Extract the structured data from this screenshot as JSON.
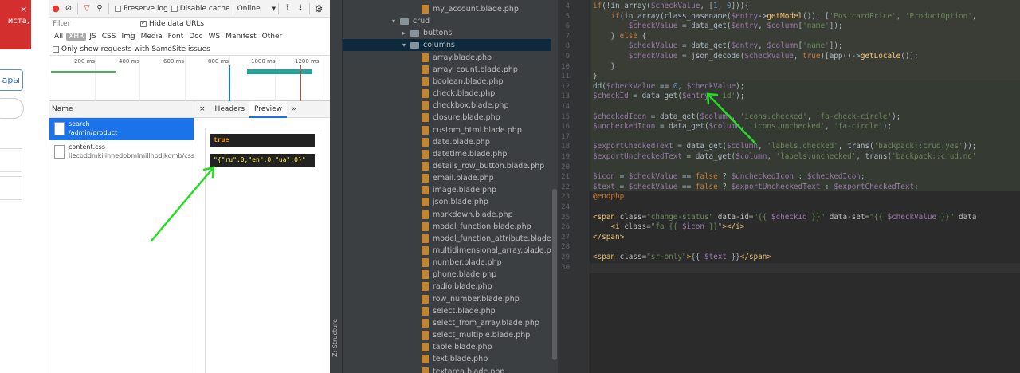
{
  "left_strip": {
    "alert_text_1": "иста,",
    "alert_close": "×",
    "button_label": "ары"
  },
  "devtools": {
    "toolbar": {
      "preserve_log": "Preserve log",
      "disable_cache": "Disable cache",
      "throttle": "Online"
    },
    "filter_placeholder": "Filter",
    "hide_data_urls": "Hide data URLs",
    "filter_types": [
      "All",
      "XHR",
      "JS",
      "CSS",
      "Img",
      "Media",
      "Font",
      "Doc",
      "WS",
      "Manifest",
      "Other"
    ],
    "selected_type": "XHR",
    "same_site": "Only show requests with SameSite issues",
    "timeline_ticks": [
      "200 ms",
      "400 ms",
      "600 ms",
      "800 ms",
      "1000 ms",
      "1200 ms"
    ],
    "name_header": "Name",
    "requests": [
      {
        "name": "search",
        "path": "/admin/product"
      },
      {
        "name": "content.css",
        "path": "liecbddmkiiihnedobmlmillhodjkdmb/css"
      }
    ],
    "detail_tabs": [
      "×",
      "Headers",
      "Preview",
      "»"
    ],
    "preview_lines": [
      "true",
      "\"{\"ru\":0,\"en\":0,\"ua\":0}\""
    ]
  },
  "ide": {
    "structure_label": "Z: Structure",
    "tree": [
      {
        "label": "my_account.blade.php",
        "type": "file",
        "indent": 2
      },
      {
        "label": "crud",
        "type": "folder",
        "indent": 0,
        "open": true
      },
      {
        "label": "buttons",
        "type": "folder",
        "indent": 1,
        "open": false
      },
      {
        "label": "columns",
        "type": "folder",
        "indent": 1,
        "open": true
      },
      {
        "label": "array.blade.php",
        "type": "file",
        "indent": 2
      },
      {
        "label": "array_count.blade.php",
        "type": "file",
        "indent": 2
      },
      {
        "label": "boolean.blade.php",
        "type": "file",
        "indent": 2
      },
      {
        "label": "check.blade.php",
        "type": "file",
        "indent": 2
      },
      {
        "label": "checkbox.blade.php",
        "type": "file",
        "indent": 2
      },
      {
        "label": "closure.blade.php",
        "type": "file",
        "indent": 2
      },
      {
        "label": "custom_html.blade.php",
        "type": "file",
        "indent": 2
      },
      {
        "label": "date.blade.php",
        "type": "file",
        "indent": 2
      },
      {
        "label": "datetime.blade.php",
        "type": "file",
        "indent": 2
      },
      {
        "label": "details_row_button.blade.php",
        "type": "file",
        "indent": 2
      },
      {
        "label": "email.blade.php",
        "type": "file",
        "indent": 2
      },
      {
        "label": "image.blade.php",
        "type": "file",
        "indent": 2
      },
      {
        "label": "json.blade.php",
        "type": "file",
        "indent": 2
      },
      {
        "label": "markdown.blade.php",
        "type": "file",
        "indent": 2
      },
      {
        "label": "model_function.blade.php",
        "type": "file",
        "indent": 2
      },
      {
        "label": "model_function_attribute.blade.php",
        "type": "file",
        "indent": 2
      },
      {
        "label": "multidimensional_array.blade.php",
        "type": "file",
        "indent": 2
      },
      {
        "label": "number.blade.php",
        "type": "file",
        "indent": 2
      },
      {
        "label": "phone.blade.php",
        "type": "file",
        "indent": 2
      },
      {
        "label": "radio.blade.php",
        "type": "file",
        "indent": 2
      },
      {
        "label": "row_number.blade.php",
        "type": "file",
        "indent": 2
      },
      {
        "label": "select.blade.php",
        "type": "file",
        "indent": 2
      },
      {
        "label": "select_from_array.blade.php",
        "type": "file",
        "indent": 2
      },
      {
        "label": "select_multiple.blade.php",
        "type": "file",
        "indent": 2
      },
      {
        "label": "table.blade.php",
        "type": "file",
        "indent": 2
      },
      {
        "label": "text.blade.php",
        "type": "file",
        "indent": 2
      },
      {
        "label": "textarea.blade.php",
        "type": "file",
        "indent": 2
      }
    ],
    "line_numbers": [
      "4",
      "5",
      "6",
      "7",
      "8",
      "9",
      "10",
      "11",
      "12",
      "13",
      "14",
      "15",
      "16",
      "17",
      "18",
      "19",
      "20",
      "21",
      "22",
      "23",
      "24",
      "25",
      "26",
      "27",
      "28",
      "29",
      "30"
    ],
    "code_lines": [
      [
        [
          "kw",
          "if"
        ],
        [
          "",
          "(!in_array("
        ],
        [
          "var",
          "$checkValue"
        ],
        [
          "",
          ", ["
        ],
        [
          "num",
          "1"
        ],
        [
          "",
          ", "
        ],
        [
          "num",
          "0"
        ],
        [
          "",
          "])){"
        ]
      ],
      [
        [
          "",
          "    "
        ],
        [
          "kw",
          "if"
        ],
        [
          "",
          "(in_array(class_basename("
        ],
        [
          "var",
          "$entry"
        ],
        [
          "",
          "->"
        ],
        [
          "fn",
          "getModel"
        ],
        [
          "",
          "()), ["
        ],
        [
          "str",
          "'PostcardPrice'"
        ],
        [
          "",
          ", "
        ],
        [
          "str",
          "'ProductOption'"
        ],
        [
          "",
          ","
        ]
      ],
      [
        [
          "",
          "        "
        ],
        [
          "var",
          "$checkValue"
        ],
        [
          "",
          " = data_get("
        ],
        [
          "var",
          "$entry"
        ],
        [
          "",
          ", "
        ],
        [
          "var",
          "$column"
        ],
        [
          "",
          "["
        ],
        [
          "str",
          "'name'"
        ],
        [
          "",
          "]);"
        ]
      ],
      [
        [
          "",
          "    } "
        ],
        [
          "kw",
          "else"
        ],
        [
          "",
          " {"
        ]
      ],
      [
        [
          "",
          "        "
        ],
        [
          "var",
          "$checkValue"
        ],
        [
          "",
          " = data_get("
        ],
        [
          "var",
          "$entry"
        ],
        [
          "",
          ", "
        ],
        [
          "var",
          "$column"
        ],
        [
          "",
          "["
        ],
        [
          "str",
          "'name'"
        ],
        [
          "",
          "]);"
        ]
      ],
      [
        [
          "",
          "        "
        ],
        [
          "var",
          "$checkValue"
        ],
        [
          "",
          " = json_decode("
        ],
        [
          "var",
          "$checkValue"
        ],
        [
          "",
          ", "
        ],
        [
          "kw",
          "true"
        ],
        [
          "",
          ")[app()->"
        ],
        [
          "fn",
          "getLocale"
        ],
        [
          "",
          "()];"
        ]
      ],
      [
        [
          "",
          "    }"
        ]
      ],
      [
        [
          "",
          "}"
        ]
      ],
      [
        [
          "",
          "dd("
        ],
        [
          "var",
          "$checkValue"
        ],
        [
          "",
          " == "
        ],
        [
          "num",
          "0"
        ],
        [
          "",
          ", "
        ],
        [
          "var",
          "$checkValue"
        ],
        [
          "",
          ");"
        ]
      ],
      [
        [
          "var",
          "$checkId"
        ],
        [
          "",
          " = data_get("
        ],
        [
          "var",
          "$entry"
        ],
        [
          "",
          ", "
        ],
        [
          "str",
          "'id'"
        ],
        [
          "",
          ");"
        ]
      ],
      [
        [
          "",
          ""
        ]
      ],
      [
        [
          "var",
          "$checkedIcon"
        ],
        [
          "",
          " = data_get("
        ],
        [
          "var",
          "$column"
        ],
        [
          "",
          ", "
        ],
        [
          "str",
          "'icons.checked'"
        ],
        [
          "",
          ", "
        ],
        [
          "str",
          "'fa-check-circle'"
        ],
        [
          "",
          ");"
        ]
      ],
      [
        [
          "var",
          "$uncheckedIcon"
        ],
        [
          "",
          " = data_get("
        ],
        [
          "var",
          "$column"
        ],
        [
          "",
          ", "
        ],
        [
          "str",
          "'icons.unchecked'"
        ],
        [
          "",
          ", "
        ],
        [
          "str",
          "'fa-circle'"
        ],
        [
          "",
          ");"
        ]
      ],
      [
        [
          "",
          ""
        ]
      ],
      [
        [
          "var",
          "$exportCheckedText"
        ],
        [
          "",
          " = data_get("
        ],
        [
          "var",
          "$column"
        ],
        [
          "",
          ", "
        ],
        [
          "str",
          "'labels.checked'"
        ],
        [
          "",
          ", trans("
        ],
        [
          "str",
          "'backpack::crud.yes'"
        ],
        [
          "",
          "));"
        ]
      ],
      [
        [
          "var",
          "$exportUncheckedText"
        ],
        [
          "",
          " = data_get("
        ],
        [
          "var",
          "$column"
        ],
        [
          "",
          ", "
        ],
        [
          "str",
          "'labels.unchecked'"
        ],
        [
          "",
          ", trans("
        ],
        [
          "str",
          "'backpack::crud.no'"
        ],
        [
          "",
          ""
        ]
      ],
      [
        [
          "",
          ""
        ]
      ],
      [
        [
          "var",
          "$icon"
        ],
        [
          "",
          " = "
        ],
        [
          "var",
          "$checkValue"
        ],
        [
          "",
          " == "
        ],
        [
          "kw",
          "false"
        ],
        [
          "",
          " ? "
        ],
        [
          "var",
          "$uncheckedIcon"
        ],
        [
          "",
          " : "
        ],
        [
          "var",
          "$checkedIcon"
        ],
        [
          "",
          ";"
        ]
      ],
      [
        [
          "var",
          "$text"
        ],
        [
          "",
          " = "
        ],
        [
          "var",
          "$checkValue"
        ],
        [
          "",
          " == "
        ],
        [
          "kw",
          "false"
        ],
        [
          "",
          " ? "
        ],
        [
          "var",
          "$exportUncheckedText"
        ],
        [
          "",
          " : "
        ],
        [
          "var",
          "$exportCheckedText"
        ],
        [
          "",
          ";"
        ]
      ],
      [
        [
          "bl",
          "@endphp"
        ]
      ],
      [
        [
          "",
          ""
        ]
      ],
      [
        [
          "tag",
          "<span "
        ],
        [
          "attr",
          "class="
        ],
        [
          "str",
          "\"change-status\""
        ],
        [
          "attr",
          " data-id="
        ],
        [
          "str",
          "\"{{ "
        ],
        [
          "var",
          "$checkId"
        ],
        [
          "str",
          " }}\""
        ],
        [
          "attr",
          " data-set="
        ],
        [
          "str",
          "\"{{ "
        ],
        [
          "var",
          "$checkValue"
        ],
        [
          "str",
          " }}\""
        ],
        [
          "attr",
          " data"
        ]
      ],
      [
        [
          "",
          "    "
        ],
        [
          "tag",
          "<i "
        ],
        [
          "attr",
          "class="
        ],
        [
          "str",
          "\"fa {{ "
        ],
        [
          "var",
          "$icon"
        ],
        [
          "str",
          " }}\""
        ],
        [
          "tag",
          "></i>"
        ]
      ],
      [
        [
          "tag",
          "</span>"
        ]
      ],
      [
        [
          "",
          ""
        ]
      ],
      [
        [
          "tag",
          "<span "
        ],
        [
          "attr",
          "class="
        ],
        [
          "str",
          "\"sr-only\""
        ],
        [
          "tag",
          ">"
        ],
        [
          "",
          "{{ "
        ],
        [
          "var",
          "$text"
        ],
        [
          "",
          " }}"
        ],
        [
          "tag",
          "</span>"
        ]
      ],
      [
        [
          "",
          ""
        ]
      ]
    ]
  },
  "colors": {
    "accent_blue": "#1a73e8",
    "annotation_green": "#22dd22",
    "editor_bg": "#2b2b2b",
    "tree_bg": "#3c3f41"
  }
}
